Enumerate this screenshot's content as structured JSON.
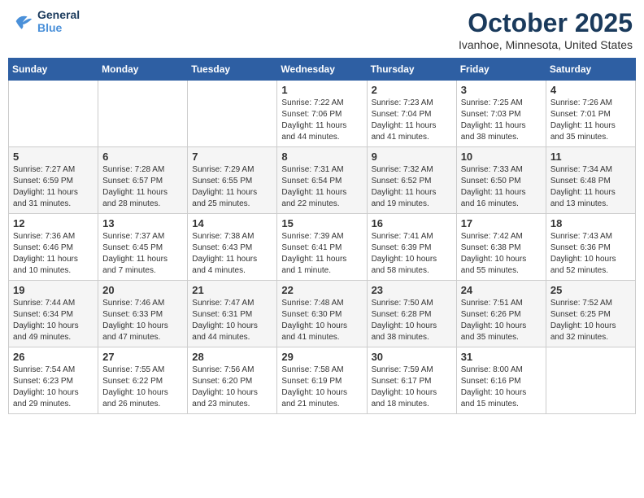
{
  "header": {
    "logo_line1": "General",
    "logo_line2": "Blue",
    "month": "October 2025",
    "location": "Ivanhoe, Minnesota, United States"
  },
  "weekdays": [
    "Sunday",
    "Monday",
    "Tuesday",
    "Wednesday",
    "Thursday",
    "Friday",
    "Saturday"
  ],
  "weeks": [
    [
      {
        "day": "",
        "sunrise": "",
        "sunset": "",
        "daylight": ""
      },
      {
        "day": "",
        "sunrise": "",
        "sunset": "",
        "daylight": ""
      },
      {
        "day": "",
        "sunrise": "",
        "sunset": "",
        "daylight": ""
      },
      {
        "day": "1",
        "sunrise": "Sunrise: 7:22 AM",
        "sunset": "Sunset: 7:06 PM",
        "daylight": "Daylight: 11 hours and 44 minutes."
      },
      {
        "day": "2",
        "sunrise": "Sunrise: 7:23 AM",
        "sunset": "Sunset: 7:04 PM",
        "daylight": "Daylight: 11 hours and 41 minutes."
      },
      {
        "day": "3",
        "sunrise": "Sunrise: 7:25 AM",
        "sunset": "Sunset: 7:03 PM",
        "daylight": "Daylight: 11 hours and 38 minutes."
      },
      {
        "day": "4",
        "sunrise": "Sunrise: 7:26 AM",
        "sunset": "Sunset: 7:01 PM",
        "daylight": "Daylight: 11 hours and 35 minutes."
      }
    ],
    [
      {
        "day": "5",
        "sunrise": "Sunrise: 7:27 AM",
        "sunset": "Sunset: 6:59 PM",
        "daylight": "Daylight: 11 hours and 31 minutes."
      },
      {
        "day": "6",
        "sunrise": "Sunrise: 7:28 AM",
        "sunset": "Sunset: 6:57 PM",
        "daylight": "Daylight: 11 hours and 28 minutes."
      },
      {
        "day": "7",
        "sunrise": "Sunrise: 7:29 AM",
        "sunset": "Sunset: 6:55 PM",
        "daylight": "Daylight: 11 hours and 25 minutes."
      },
      {
        "day": "8",
        "sunrise": "Sunrise: 7:31 AM",
        "sunset": "Sunset: 6:54 PM",
        "daylight": "Daylight: 11 hours and 22 minutes."
      },
      {
        "day": "9",
        "sunrise": "Sunrise: 7:32 AM",
        "sunset": "Sunset: 6:52 PM",
        "daylight": "Daylight: 11 hours and 19 minutes."
      },
      {
        "day": "10",
        "sunrise": "Sunrise: 7:33 AM",
        "sunset": "Sunset: 6:50 PM",
        "daylight": "Daylight: 11 hours and 16 minutes."
      },
      {
        "day": "11",
        "sunrise": "Sunrise: 7:34 AM",
        "sunset": "Sunset: 6:48 PM",
        "daylight": "Daylight: 11 hours and 13 minutes."
      }
    ],
    [
      {
        "day": "12",
        "sunrise": "Sunrise: 7:36 AM",
        "sunset": "Sunset: 6:46 PM",
        "daylight": "Daylight: 11 hours and 10 minutes."
      },
      {
        "day": "13",
        "sunrise": "Sunrise: 7:37 AM",
        "sunset": "Sunset: 6:45 PM",
        "daylight": "Daylight: 11 hours and 7 minutes."
      },
      {
        "day": "14",
        "sunrise": "Sunrise: 7:38 AM",
        "sunset": "Sunset: 6:43 PM",
        "daylight": "Daylight: 11 hours and 4 minutes."
      },
      {
        "day": "15",
        "sunrise": "Sunrise: 7:39 AM",
        "sunset": "Sunset: 6:41 PM",
        "daylight": "Daylight: 11 hours and 1 minute."
      },
      {
        "day": "16",
        "sunrise": "Sunrise: 7:41 AM",
        "sunset": "Sunset: 6:39 PM",
        "daylight": "Daylight: 10 hours and 58 minutes."
      },
      {
        "day": "17",
        "sunrise": "Sunrise: 7:42 AM",
        "sunset": "Sunset: 6:38 PM",
        "daylight": "Daylight: 10 hours and 55 minutes."
      },
      {
        "day": "18",
        "sunrise": "Sunrise: 7:43 AM",
        "sunset": "Sunset: 6:36 PM",
        "daylight": "Daylight: 10 hours and 52 minutes."
      }
    ],
    [
      {
        "day": "19",
        "sunrise": "Sunrise: 7:44 AM",
        "sunset": "Sunset: 6:34 PM",
        "daylight": "Daylight: 10 hours and 49 minutes."
      },
      {
        "day": "20",
        "sunrise": "Sunrise: 7:46 AM",
        "sunset": "Sunset: 6:33 PM",
        "daylight": "Daylight: 10 hours and 47 minutes."
      },
      {
        "day": "21",
        "sunrise": "Sunrise: 7:47 AM",
        "sunset": "Sunset: 6:31 PM",
        "daylight": "Daylight: 10 hours and 44 minutes."
      },
      {
        "day": "22",
        "sunrise": "Sunrise: 7:48 AM",
        "sunset": "Sunset: 6:30 PM",
        "daylight": "Daylight: 10 hours and 41 minutes."
      },
      {
        "day": "23",
        "sunrise": "Sunrise: 7:50 AM",
        "sunset": "Sunset: 6:28 PM",
        "daylight": "Daylight: 10 hours and 38 minutes."
      },
      {
        "day": "24",
        "sunrise": "Sunrise: 7:51 AM",
        "sunset": "Sunset: 6:26 PM",
        "daylight": "Daylight: 10 hours and 35 minutes."
      },
      {
        "day": "25",
        "sunrise": "Sunrise: 7:52 AM",
        "sunset": "Sunset: 6:25 PM",
        "daylight": "Daylight: 10 hours and 32 minutes."
      }
    ],
    [
      {
        "day": "26",
        "sunrise": "Sunrise: 7:54 AM",
        "sunset": "Sunset: 6:23 PM",
        "daylight": "Daylight: 10 hours and 29 minutes."
      },
      {
        "day": "27",
        "sunrise": "Sunrise: 7:55 AM",
        "sunset": "Sunset: 6:22 PM",
        "daylight": "Daylight: 10 hours and 26 minutes."
      },
      {
        "day": "28",
        "sunrise": "Sunrise: 7:56 AM",
        "sunset": "Sunset: 6:20 PM",
        "daylight": "Daylight: 10 hours and 23 minutes."
      },
      {
        "day": "29",
        "sunrise": "Sunrise: 7:58 AM",
        "sunset": "Sunset: 6:19 PM",
        "daylight": "Daylight: 10 hours and 21 minutes."
      },
      {
        "day": "30",
        "sunrise": "Sunrise: 7:59 AM",
        "sunset": "Sunset: 6:17 PM",
        "daylight": "Daylight: 10 hours and 18 minutes."
      },
      {
        "day": "31",
        "sunrise": "Sunrise: 8:00 AM",
        "sunset": "Sunset: 6:16 PM",
        "daylight": "Daylight: 10 hours and 15 minutes."
      },
      {
        "day": "",
        "sunrise": "",
        "sunset": "",
        "daylight": ""
      }
    ]
  ]
}
